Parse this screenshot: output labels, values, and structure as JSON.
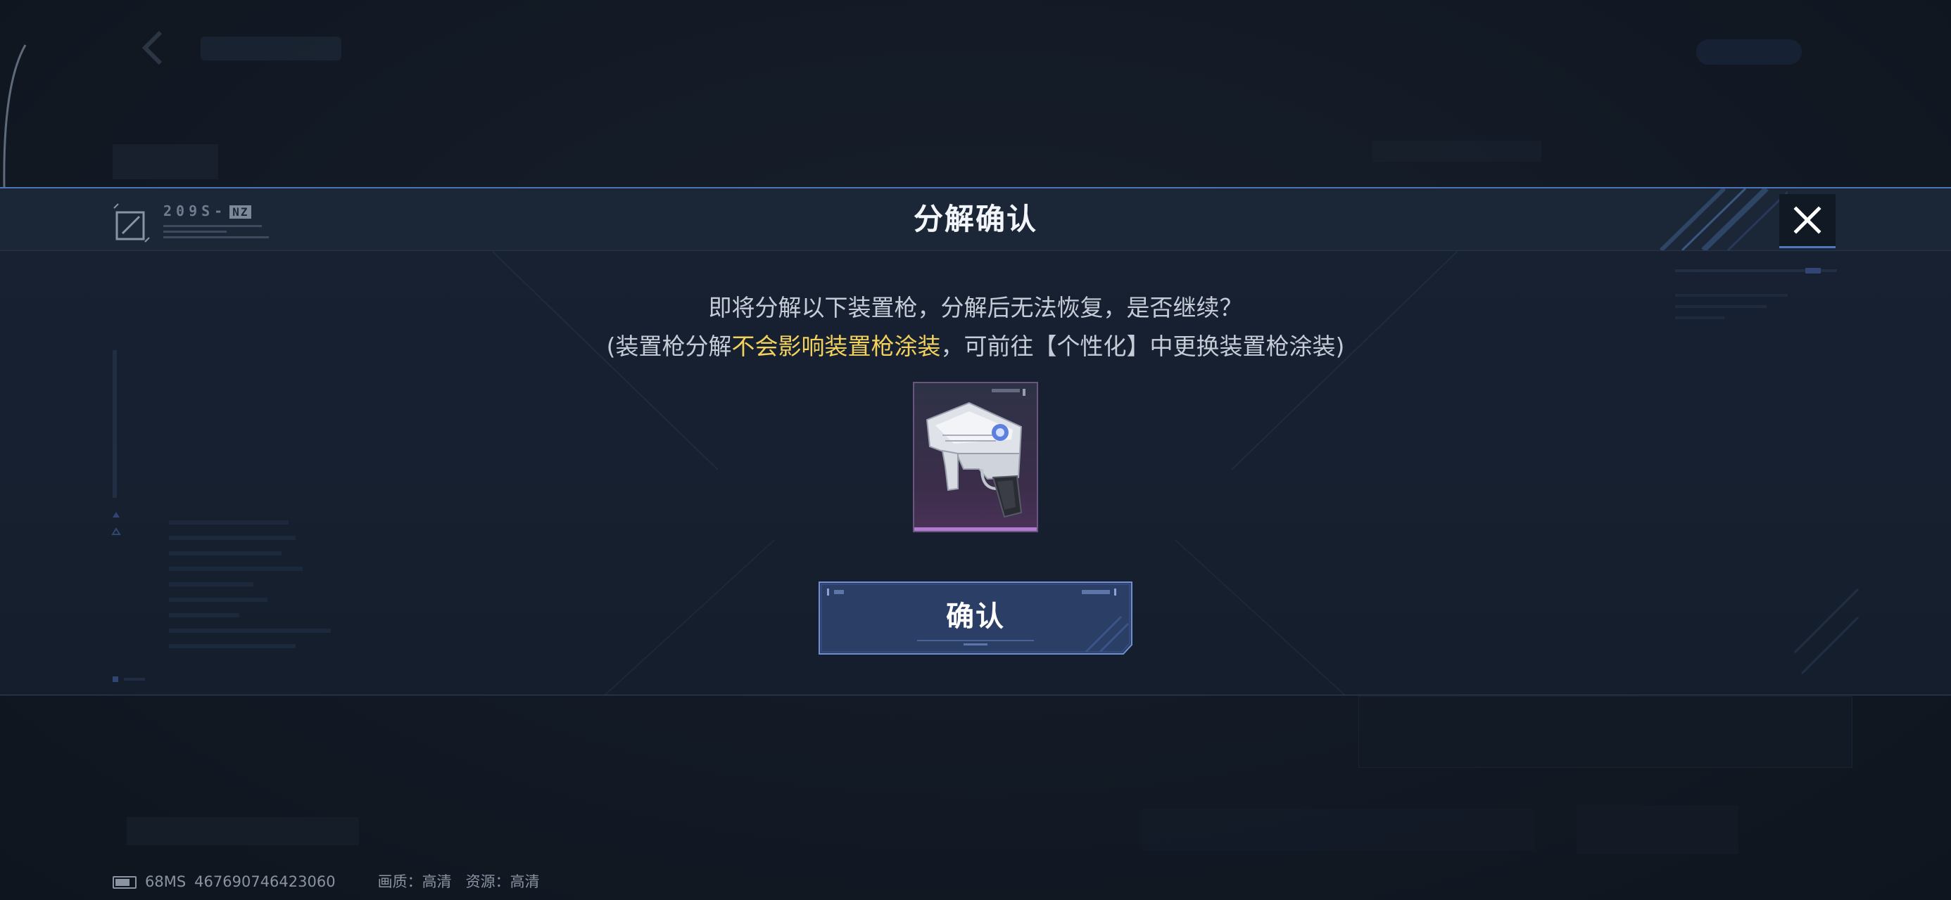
{
  "dialog": {
    "title": "分解确认",
    "logo_code": "209S-",
    "logo_badge": "NZ",
    "message_line1": "即将分解以下装置枪，分解后无法恢复，是否继续？",
    "message_line2_pre": "(装置枪分解",
    "message_line2_highlight": "不会影响装置枪涂装",
    "message_line2_post": "，可前往【个性化】中更换装置枪涂装)",
    "confirm_label": "确认",
    "close_icon": "close-icon"
  },
  "weapon_card": {
    "icon": "pistol-weapon-icon",
    "rarity_color": "#b07bd0"
  },
  "status_bar": {
    "ping": "68MS",
    "uid": "467690746423060",
    "quality_label": "画质：",
    "quality_value": "高清",
    "resource_label": "资源：",
    "resource_value": "高清"
  },
  "colors": {
    "accent_blue": "#4a74b8",
    "highlight_yellow": "#f2d15c",
    "title_text": "#f2f5fa",
    "body_text": "#c5ccd7"
  }
}
